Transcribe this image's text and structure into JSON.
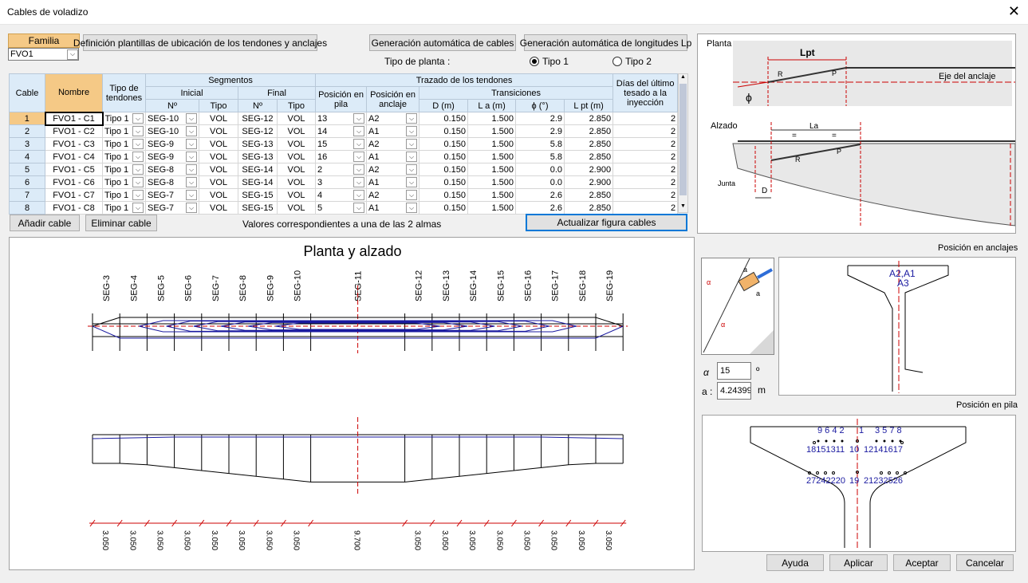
{
  "window": {
    "title": "Cables de voladizo",
    "close_icon": "close-icon"
  },
  "familia": {
    "label": "Familia",
    "value": "FVO1"
  },
  "buttons": {
    "definicion": "Definición plantillas de ubicación de los tendones y anclajes",
    "gen_cables": "Generación automática de cables",
    "gen_longitudes": "Generación automática de longitudes Lp",
    "add": "Añadir cable",
    "del": "Eliminar cable",
    "update": "Actualizar figura cables",
    "help": "Ayuda",
    "apply": "Aplicar",
    "accept": "Aceptar",
    "cancel": "Cancelar"
  },
  "tipo_planta": {
    "label": "Tipo de planta :",
    "opt1": "Tipo 1",
    "opt2": "Tipo 2"
  },
  "note": "Valores correspondientes a una de las 2 almas",
  "headers": {
    "cable": "Cable",
    "nombre": "Nombre",
    "tipo_tendones": "Tipo de tendones",
    "segmentos": "Segmentos",
    "inicial": "Inicial",
    "final": "Final",
    "no": "Nº",
    "tipo": "Tipo",
    "trazado": "Trazado de los tendones",
    "pos_pila": "Posición en pila",
    "pos_anclaje": "Posición en anclaje",
    "transiciones": "Transiciones",
    "d": "D (m)",
    "la": "L a (m)",
    "phi": "ϕ (°)",
    "lpt": "L pt (m)",
    "dias": "Días del último tesado a la inyección"
  },
  "rows": [
    {
      "n": "1",
      "nombre": "FVO1 - C1",
      "tipo": "Tipo 1",
      "ini": "SEG-10",
      "tini": "VOL",
      "fin": "SEG-12",
      "tfin": "VOL",
      "pila": "13",
      "anc": "A2",
      "d": "0.150",
      "la": "1.500",
      "phi": "2.9",
      "lpt": "2.850",
      "dias": "2"
    },
    {
      "n": "2",
      "nombre": "FVO1 - C2",
      "tipo": "Tipo 1",
      "ini": "SEG-10",
      "tini": "VOL",
      "fin": "SEG-12",
      "tfin": "VOL",
      "pila": "14",
      "anc": "A1",
      "d": "0.150",
      "la": "1.500",
      "phi": "2.9",
      "lpt": "2.850",
      "dias": "2"
    },
    {
      "n": "3",
      "nombre": "FVO1 - C3",
      "tipo": "Tipo 1",
      "ini": "SEG-9",
      "tini": "VOL",
      "fin": "SEG-13",
      "tfin": "VOL",
      "pila": "15",
      "anc": "A2",
      "d": "0.150",
      "la": "1.500",
      "phi": "5.8",
      "lpt": "2.850",
      "dias": "2"
    },
    {
      "n": "4",
      "nombre": "FVO1 - C4",
      "tipo": "Tipo 1",
      "ini": "SEG-9",
      "tini": "VOL",
      "fin": "SEG-13",
      "tfin": "VOL",
      "pila": "16",
      "anc": "A1",
      "d": "0.150",
      "la": "1.500",
      "phi": "5.8",
      "lpt": "2.850",
      "dias": "2"
    },
    {
      "n": "5",
      "nombre": "FVO1 - C5",
      "tipo": "Tipo 1",
      "ini": "SEG-8",
      "tini": "VOL",
      "fin": "SEG-14",
      "tfin": "VOL",
      "pila": "2",
      "anc": "A2",
      "d": "0.150",
      "la": "1.500",
      "phi": "0.0",
      "lpt": "2.900",
      "dias": "2"
    },
    {
      "n": "6",
      "nombre": "FVO1 - C6",
      "tipo": "Tipo 1",
      "ini": "SEG-8",
      "tini": "VOL",
      "fin": "SEG-14",
      "tfin": "VOL",
      "pila": "3",
      "anc": "A1",
      "d": "0.150",
      "la": "1.500",
      "phi": "0.0",
      "lpt": "2.900",
      "dias": "2"
    },
    {
      "n": "7",
      "nombre": "FVO1 - C7",
      "tipo": "Tipo 1",
      "ini": "SEG-7",
      "tini": "VOL",
      "fin": "SEG-15",
      "tfin": "VOL",
      "pila": "4",
      "anc": "A2",
      "d": "0.150",
      "la": "1.500",
      "phi": "2.6",
      "lpt": "2.850",
      "dias": "2"
    },
    {
      "n": "8",
      "nombre": "FVO1 - C8",
      "tipo": "Tipo 1",
      "ini": "SEG-7",
      "tini": "VOL",
      "fin": "SEG-15",
      "tfin": "VOL",
      "pila": "5",
      "anc": "A1",
      "d": "0.150",
      "la": "1.500",
      "phi": "2.6",
      "lpt": "2.850",
      "dias": "2"
    }
  ],
  "drawing": {
    "title": "Planta y alzado",
    "segments": [
      "SEG-3",
      "SEG-4",
      "SEG-5",
      "SEG-6",
      "SEG-7",
      "SEG-8",
      "SEG-9",
      "SEG-10",
      "SEG-11",
      "SEG-12",
      "SEG-13",
      "SEG-14",
      "SEG-15",
      "SEG-16",
      "SEG-17",
      "SEG-18",
      "SEG-19"
    ],
    "dims": [
      "3.050",
      "3.050",
      "3.050",
      "3.050",
      "3.050",
      "3.050",
      "3.050",
      "3.050",
      "9.700",
      "3.050",
      "3.050",
      "3.050",
      "3.050",
      "3.050",
      "3.050",
      "3.050",
      "3.050"
    ]
  },
  "ref": {
    "planta": "Planta",
    "lpt": "Lpt",
    "eje": "Eje del anclaje",
    "alzado": "Alzado",
    "la": "La",
    "eq": "=",
    "junta": "Junta",
    "d": "D",
    "r": "R",
    "p": "P",
    "phi": "ϕ"
  },
  "anclajes": {
    "label": "Posición en anclajes",
    "labels": "A2,A1",
    "a3": "A3",
    "alpha_sym": "α",
    "alpha": "15",
    "alpha_unit": "º",
    "a_sym": "a :",
    "a": "4.24399",
    "a_unit": "m",
    "a_mark": "a"
  },
  "pila": {
    "label": "Posición en pila",
    "row1l": "9 6 4 2",
    "row1c": "1",
    "row1r": "3 5 7 8",
    "row2l": "18151311",
    "row2c": "10",
    "row2r": "12141617",
    "row3l": "27242220",
    "row3c": "19",
    "row3r": "21232526"
  },
  "colors": {
    "accent": "#0078d7",
    "header": "#dcebf8",
    "orange": "#f5c986",
    "red": "#e02020",
    "navy": "#1a1aa0"
  }
}
